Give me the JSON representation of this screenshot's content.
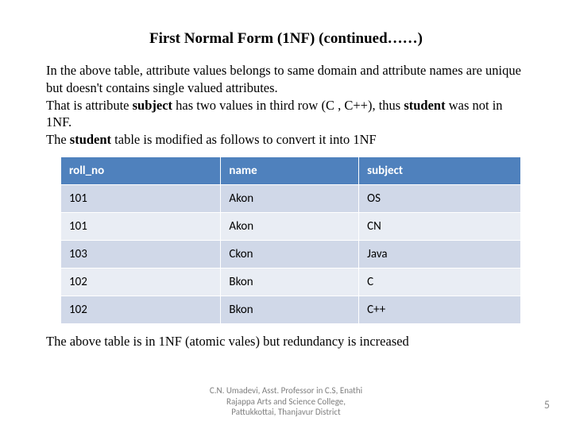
{
  "title": "First Normal Form (1NF) (continued……)",
  "para": {
    "l1a": "In the above table, attribute values belongs to same domain and  attribute names are unique but doesn't contains single valued attributes.",
    "l2a": "That is attribute ",
    "l2b": "subject",
    "l2c": " has two values in third row (C , C++),  thus ",
    "l2d": "student",
    "l2e": " was not in 1NF.",
    "l3a": "The ",
    "l3b": "student",
    "l3c": " table is modified as follows to convert it into 1NF"
  },
  "table": {
    "headers": {
      "c1": "roll_no",
      "c2": "name",
      "c3": "subject"
    },
    "rows": [
      {
        "c1": "101",
        "c2": "Akon",
        "c3": "OS"
      },
      {
        "c1": "101",
        "c2": "Akon",
        "c3": "CN"
      },
      {
        "c1": "103",
        "c2": "Ckon",
        "c3": "Java"
      },
      {
        "c1": "102",
        "c2": "Bkon",
        "c3": "C"
      },
      {
        "c1": "102",
        "c2": "Bkon",
        "c3": "C++"
      }
    ]
  },
  "footnote": "The above table is in 1NF (atomic vales) but redundancy is increased",
  "attribution": {
    "l1": "C.N. Umadevi, Asst. Professor in C.S, Enathi",
    "l2": "Rajappa Arts and Science College,",
    "l3": "Pattukkottai, Thanjavur District"
  },
  "page": "5"
}
